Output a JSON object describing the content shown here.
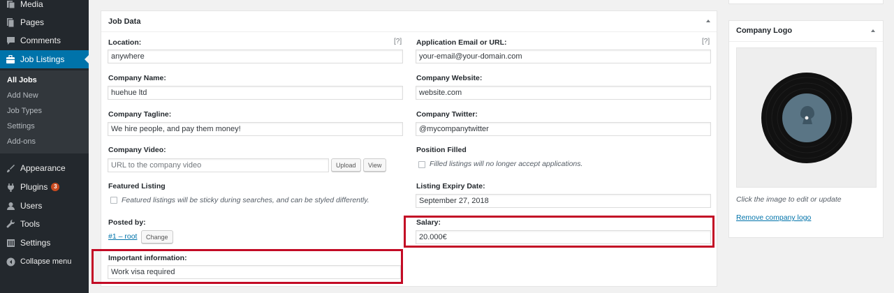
{
  "sidebar": {
    "items": [
      {
        "label": "Media",
        "icon": "media-icon"
      },
      {
        "label": "Pages",
        "icon": "pages-icon"
      },
      {
        "label": "Comments",
        "icon": "comments-icon"
      },
      {
        "label": "Job Listings",
        "icon": "briefcase-icon"
      },
      {
        "label": "Appearance",
        "icon": "paintbrush-icon"
      },
      {
        "label": "Plugins",
        "icon": "plug-icon",
        "badge": "3"
      },
      {
        "label": "Users",
        "icon": "user-icon"
      },
      {
        "label": "Tools",
        "icon": "wrench-icon"
      },
      {
        "label": "Settings",
        "icon": "settings-icon"
      },
      {
        "label": "Collapse menu",
        "icon": "collapse-icon"
      }
    ],
    "submenu": [
      "All Jobs",
      "Add New",
      "Job Types",
      "Settings",
      "Add-ons"
    ]
  },
  "job_data": {
    "title": "Job Data",
    "help_glyph": "[?]",
    "location": {
      "label": "Location:",
      "value": "anywhere"
    },
    "application": {
      "label": "Application Email or URL:",
      "value": "your-email@your-domain.com"
    },
    "company_name": {
      "label": "Company Name:",
      "value": "huehue ltd"
    },
    "company_website": {
      "label": "Company Website:",
      "value": "website.com"
    },
    "company_tagline": {
      "label": "Company Tagline:",
      "value": "We hire people, and pay them money!"
    },
    "company_twitter": {
      "label": "Company Twitter:",
      "value": "@mycompanytwitter"
    },
    "company_video": {
      "label": "Company Video:",
      "value": "",
      "placeholder": "URL to the company video",
      "upload_label": "Upload",
      "view_label": "View"
    },
    "position_filled": {
      "label": "Position Filled",
      "description": "Filled listings will no longer accept applications.",
      "checked": false
    },
    "featured_listing": {
      "label": "Featured Listing",
      "description": "Featured listings will be sticky during searches, and can be styled differently.",
      "checked": false
    },
    "expiry_date": {
      "label": "Listing Expiry Date:",
      "value": "September 27, 2018"
    },
    "posted_by": {
      "label": "Posted by:",
      "link": "#1 – root",
      "change_label": "Change"
    },
    "salary": {
      "label": "Salary:",
      "value": "20.000€"
    },
    "important_info": {
      "label": "Important information:",
      "value": "Work visa required"
    }
  },
  "company_logo": {
    "title": "Company Logo",
    "hint": "Click the image to edit or update",
    "remove_label": "Remove company logo"
  },
  "colors": {
    "admin_bar": "#23282d",
    "accent": "#0073aa",
    "highlight_border": "#c30b25",
    "badge": "#ca4a1f"
  }
}
